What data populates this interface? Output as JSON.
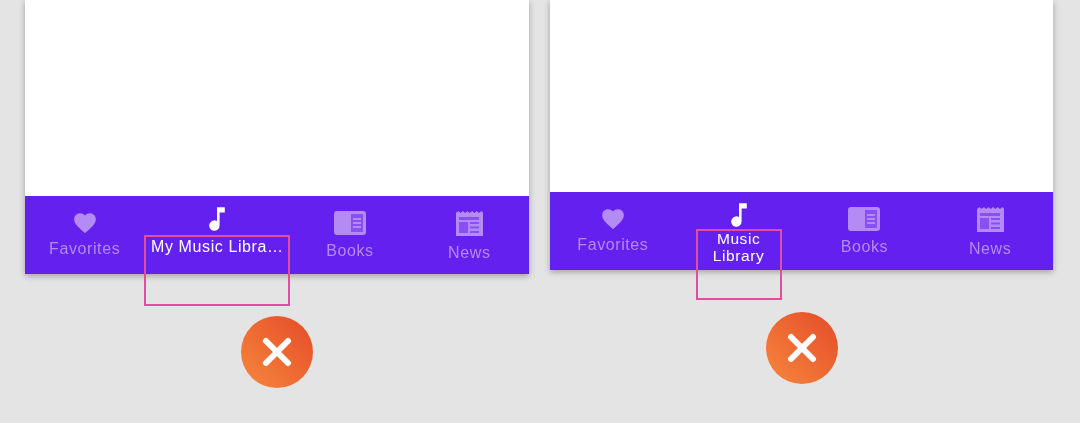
{
  "examples": [
    {
      "kind": "single_line",
      "items": [
        {
          "kind": "heart",
          "label": "Favorites",
          "selected": false
        },
        {
          "kind": "note",
          "label": "My Music Libra…",
          "selected": true
        },
        {
          "kind": "book",
          "label": "Books",
          "selected": false
        },
        {
          "kind": "news",
          "label": "News",
          "selected": false
        }
      ]
    },
    {
      "kind": "wrapped",
      "items": [
        {
          "kind": "heart",
          "label": "Favorites",
          "selected": false
        },
        {
          "kind": "note",
          "label": "Music Library",
          "selected": true
        },
        {
          "kind": "book",
          "label": "Books",
          "selected": false
        },
        {
          "kind": "news",
          "label": "News",
          "selected": false
        }
      ]
    }
  ]
}
